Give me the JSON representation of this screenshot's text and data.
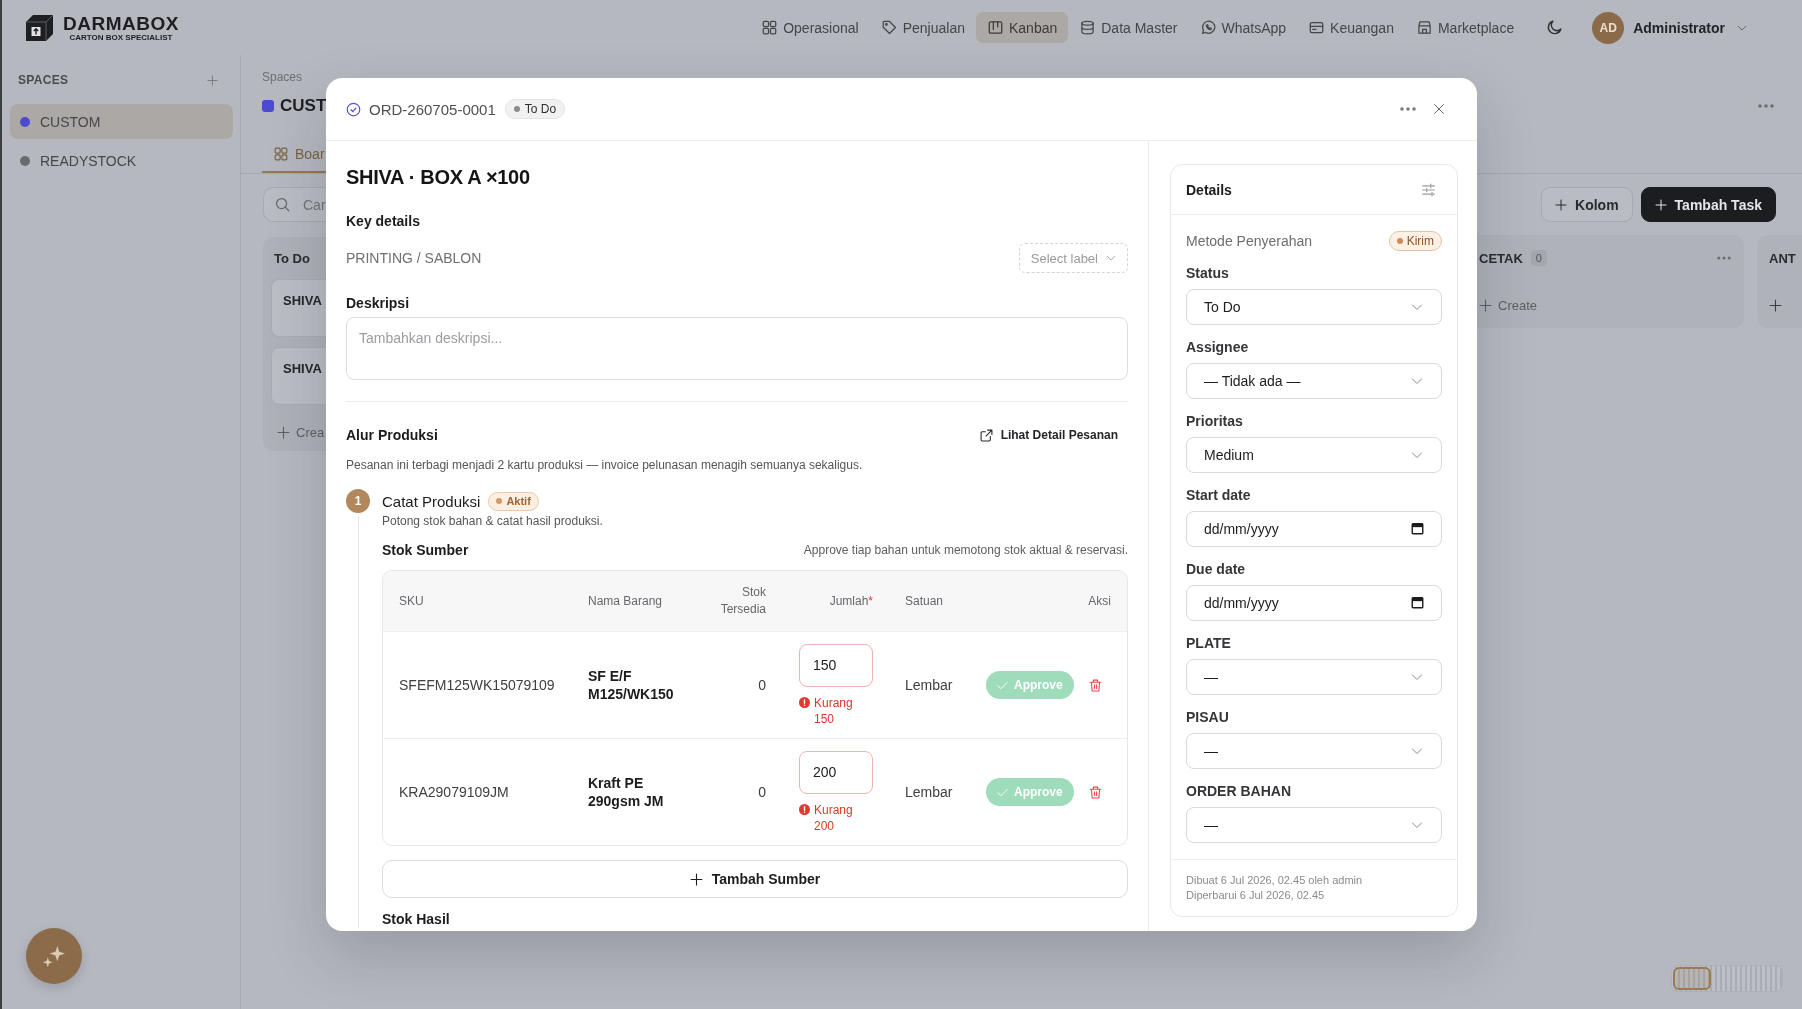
{
  "topbar": {
    "brand": "DARMABOX",
    "tagline": "CARTON BOX SPECIALIST",
    "nav": [
      {
        "label": "Operasional",
        "selected": false
      },
      {
        "label": "Penjualan",
        "selected": false
      },
      {
        "label": "Kanban",
        "selected": true
      },
      {
        "label": "Data Master",
        "selected": false
      },
      {
        "label": "WhatsApp",
        "selected": false
      },
      {
        "label": "Keuangan",
        "selected": false
      },
      {
        "label": "Marketplace",
        "selected": false
      }
    ],
    "user": {
      "initials": "AD",
      "name": "Administrator"
    }
  },
  "sidebar": {
    "heading": "SPACES",
    "items": [
      {
        "label": "CUSTOM",
        "selected": true,
        "color": "#4c4ad0"
      },
      {
        "label": "READYSTOCK",
        "selected": false,
        "color": "#686b70"
      }
    ]
  },
  "board": {
    "breadcrumb": "Spaces",
    "title": "CUST",
    "tabs": [
      {
        "label": "Boar",
        "selected": true
      }
    ],
    "search": {
      "placeholder": "Car"
    },
    "actions": [
      {
        "label": "Kolom",
        "kind": "secondary"
      },
      {
        "label": "Tambah Task",
        "kind": "primary"
      }
    ],
    "columns": [
      {
        "title": "To Do",
        "cards": [
          {
            "title": "SHIVA"
          },
          {
            "title": "SHIVA"
          }
        ],
        "create": "Crea"
      },
      {
        "title": "CETAK",
        "count": "0",
        "create": "Create"
      },
      {
        "title": "ANT"
      }
    ]
  },
  "modal": {
    "order_id": "ORD-260705-0001",
    "status": "To Do",
    "title": "SHIVA · BOX A ×100",
    "key_details": {
      "heading": "Key details",
      "category": "PRINTING / SABLON",
      "label_picker": {
        "placeholder": "Select label"
      }
    },
    "description": {
      "heading": "Deskripsi",
      "placeholder": "Tambahkan deskripsi..."
    },
    "production": {
      "heading": "Alur Produksi",
      "link": "Lihat Detail Pesanan",
      "note": "Pesanan ini terbagi menjadi 2 kartu produksi — invoice pelunasan menagih semuanya sekaligus.",
      "steps": [
        {
          "number": "1",
          "title": "Catat Produksi",
          "badge": "Aktif",
          "subtitle": "Potong stok bahan & catat hasil produksi.",
          "source": {
            "heading": "Stok Sumber",
            "hint": "Approve tiap bahan untuk memotong stok aktual & reservasi.",
            "columns": [
              {
                "label": "SKU"
              },
              {
                "label": "Nama Barang"
              },
              {
                "label": "Stok Tersedia"
              },
              {
                "label": "Jumlah",
                "required_mark": "*"
              },
              {
                "label": "Satuan"
              },
              {
                "label": "Aksi"
              }
            ],
            "rows": [
              {
                "sku": "SFEFM125WK15079109",
                "name": "SF E/F M125/WK150",
                "stock": "0",
                "quantity": "150",
                "error": true,
                "warning": "Kurang 150",
                "unit": "Lembar",
                "action": "Approve",
                "disabled": true
              },
              {
                "sku": "KRA29079109JM",
                "name": "Kraft PE 290gsm JM",
                "stock": "0",
                "quantity": "200",
                "error": true,
                "warning": "Kurang 200",
                "unit": "Lembar",
                "action": "Approve",
                "disabled": true
              }
            ],
            "add_button": "Tambah Sumber"
          },
          "result_heading": "Stok Hasil"
        }
      ]
    }
  },
  "details": {
    "heading": "Details",
    "delivery": {
      "label": "Metode Penyerahan",
      "value": "Kirim"
    },
    "fields": [
      {
        "label": "Status",
        "kind": "select",
        "value": "To Do"
      },
      {
        "label": "Assignee",
        "kind": "select",
        "value": "— Tidak ada —"
      },
      {
        "label": "Prioritas",
        "kind": "select",
        "value": "Medium"
      },
      {
        "label": "Start date",
        "kind": "date",
        "placeholder": "dd/mm/yyyy"
      },
      {
        "label": "Due date",
        "kind": "date",
        "placeholder": "dd/mm/yyyy"
      },
      {
        "label": "PLATE",
        "kind": "select",
        "value": "—"
      },
      {
        "label": "PISAU",
        "kind": "select",
        "value": "—"
      },
      {
        "label": "ORDER BAHAN",
        "kind": "select",
        "value": "—"
      }
    ],
    "footer": [
      "Dibuat 6 Jul 2026, 02.45 oleh admin",
      "Diperbarui 6 Jul 2026, 02.45"
    ]
  }
}
